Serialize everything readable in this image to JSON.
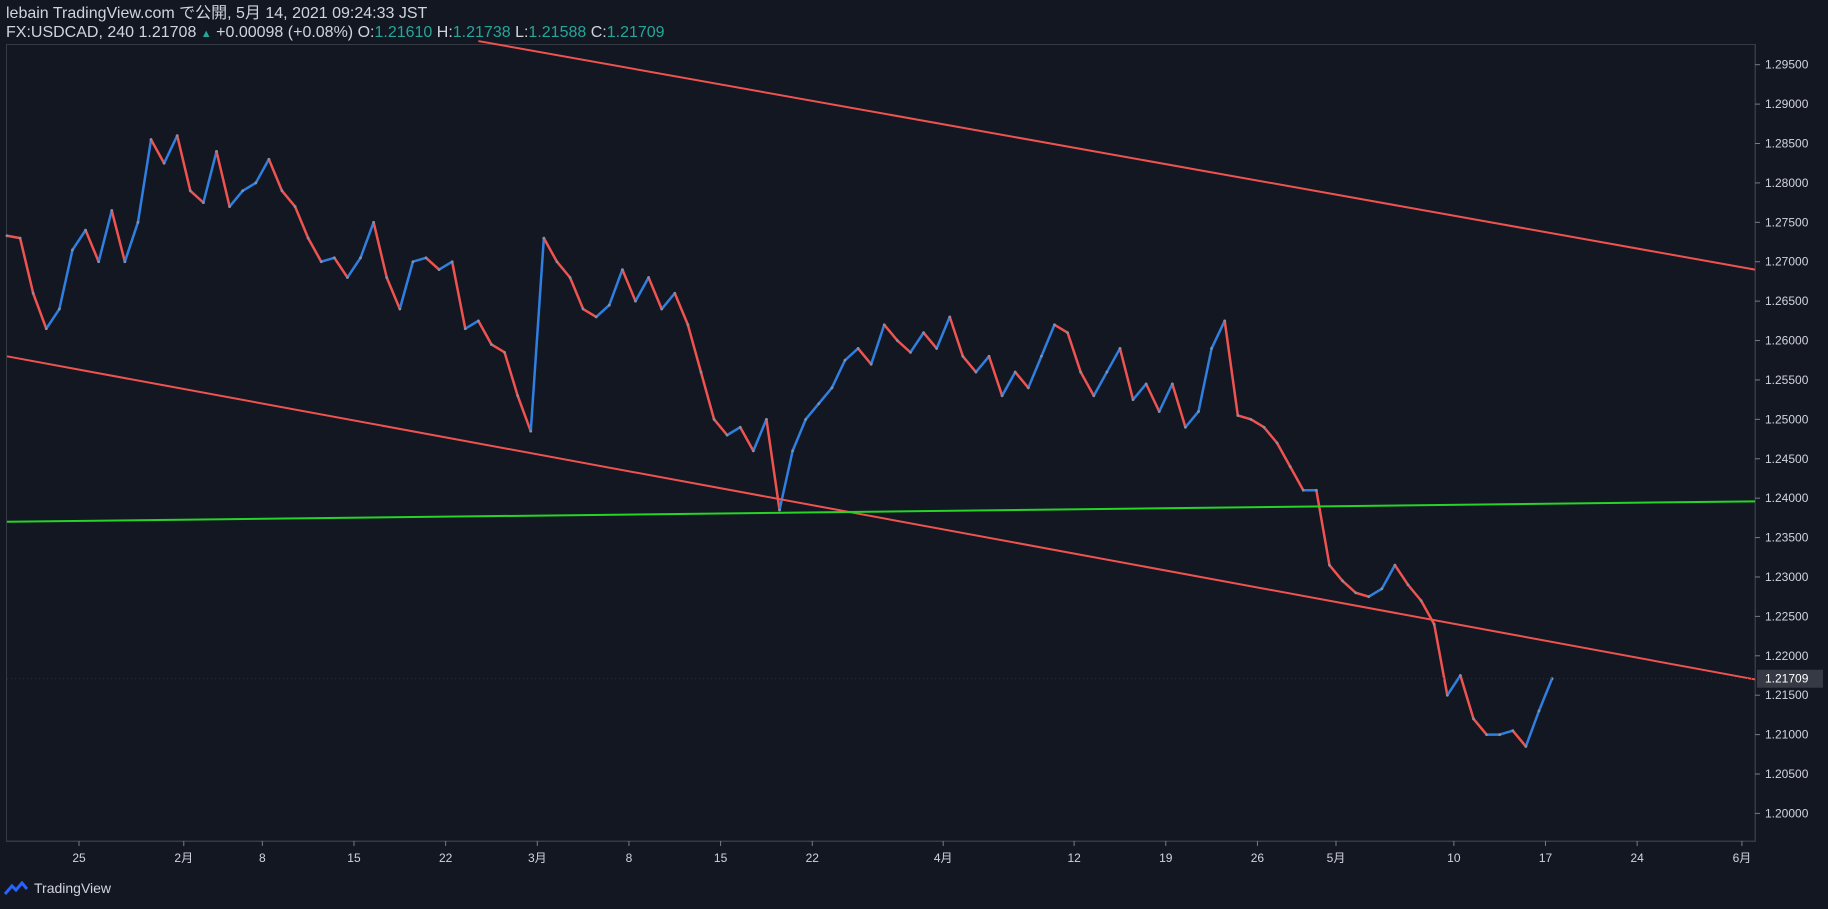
{
  "header": {
    "line1": "lebain TradingView.com で公開, 5月 14, 2021 09:24:33 JST",
    "symbol": "FX:USDCAD, 240",
    "price": "1.21708",
    "change": "+0.00098 (+0.08%)",
    "o_label": "O:",
    "o": "1.21610",
    "h_label": "H:",
    "h": "1.21738",
    "l_label": "L:",
    "l": "1.21588",
    "c_label": "C:",
    "c": "1.21709"
  },
  "footer": {
    "brand": "TradingView"
  },
  "colors": {
    "background": "#131722",
    "up": "#2f7fe0",
    "down": "#ef5350",
    "channel": "#ef5350",
    "support": "#26d426",
    "axis_text": "#d1d4dc"
  },
  "chart_data": {
    "type": "line",
    "title": "",
    "y_ticks": [
      "1.29500",
      "1.29000",
      "1.28500",
      "1.28000",
      "1.27500",
      "1.27000",
      "1.26500",
      "1.26000",
      "1.25500",
      "1.25000",
      "1.24500",
      "1.24000",
      "1.23500",
      "1.23000",
      "1.22500",
      "1.22000",
      "1.21500",
      "1.21000",
      "1.20500",
      "1.20000"
    ],
    "ylim": [
      1.1965,
      1.2975
    ],
    "x_ticks": [
      {
        "day": 25,
        "label": "25"
      },
      {
        "day": 33,
        "label": "2月"
      },
      {
        "day": 39,
        "label": "8"
      },
      {
        "day": 46,
        "label": "15"
      },
      {
        "day": 53,
        "label": "22"
      },
      {
        "day": 60,
        "label": "3月"
      },
      {
        "day": 67,
        "label": "8"
      },
      {
        "day": 74,
        "label": "15"
      },
      {
        "day": 81,
        "label": "22"
      },
      {
        "day": 91,
        "label": "4月"
      },
      {
        "day": 101,
        "label": "12"
      },
      {
        "day": 108,
        "label": "19"
      },
      {
        "day": 115,
        "label": "26"
      },
      {
        "day": 121,
        "label": "5月"
      },
      {
        "day": 130,
        "label": "10"
      },
      {
        "day": 137,
        "label": "17"
      },
      {
        "day": 144,
        "label": "24"
      },
      {
        "day": 152,
        "label": "6月"
      }
    ],
    "xlim": [
      19.5,
      153
    ],
    "last_price_label": "1.21709",
    "last_price": 1.21709,
    "series": [
      {
        "values": [
          [
            19.5,
            1.2733
          ],
          [
            20.5,
            1.273
          ],
          [
            21.5,
            1.266
          ],
          [
            22.5,
            1.2615
          ],
          [
            23.5,
            1.264
          ],
          [
            24.5,
            1.2715
          ],
          [
            25.5,
            1.274
          ],
          [
            26.5,
            1.27
          ],
          [
            27.5,
            1.2765
          ],
          [
            28.5,
            1.27
          ],
          [
            29.5,
            1.275
          ],
          [
            30.5,
            1.2855
          ],
          [
            31.5,
            1.2825
          ],
          [
            32.5,
            1.286
          ],
          [
            33.5,
            1.279
          ],
          [
            34.5,
            1.2775
          ],
          [
            35.5,
            1.284
          ],
          [
            36.5,
            1.277
          ],
          [
            37.5,
            1.279
          ],
          [
            38.5,
            1.28
          ],
          [
            39.5,
            1.283
          ],
          [
            40.5,
            1.279
          ],
          [
            41.5,
            1.277
          ],
          [
            42.5,
            1.273
          ],
          [
            43.5,
            1.27
          ],
          [
            44.5,
            1.2705
          ],
          [
            45.5,
            1.268
          ],
          [
            46.5,
            1.2705
          ],
          [
            47.5,
            1.275
          ],
          [
            48.5,
            1.268
          ],
          [
            49.5,
            1.264
          ],
          [
            50.5,
            1.27
          ],
          [
            51.5,
            1.2705
          ],
          [
            52.5,
            1.269
          ],
          [
            53.5,
            1.27
          ],
          [
            54.5,
            1.2615
          ],
          [
            55.5,
            1.2625
          ],
          [
            56.5,
            1.2595
          ],
          [
            57.5,
            1.2585
          ],
          [
            58.5,
            1.253
          ],
          [
            59.5,
            1.2485
          ],
          [
            60.5,
            1.273
          ],
          [
            61.5,
            1.27
          ],
          [
            62.5,
            1.268
          ],
          [
            63.5,
            1.264
          ],
          [
            64.5,
            1.263
          ],
          [
            65.5,
            1.2645
          ],
          [
            66.5,
            1.269
          ],
          [
            67.5,
            1.265
          ],
          [
            68.5,
            1.268
          ],
          [
            69.5,
            1.264
          ],
          [
            70.5,
            1.266
          ],
          [
            71.5,
            1.262
          ],
          [
            72.5,
            1.256
          ],
          [
            73.5,
            1.25
          ],
          [
            74.5,
            1.248
          ],
          [
            75.5,
            1.249
          ],
          [
            76.5,
            1.246
          ],
          [
            77.5,
            1.25
          ],
          [
            78.5,
            1.2385
          ],
          [
            79.5,
            1.246
          ],
          [
            80.5,
            1.25
          ],
          [
            81.5,
            1.252
          ],
          [
            82.5,
            1.254
          ],
          [
            83.5,
            1.2575
          ],
          [
            84.5,
            1.259
          ],
          [
            85.5,
            1.257
          ],
          [
            86.5,
            1.262
          ],
          [
            87.5,
            1.26
          ],
          [
            88.5,
            1.2585
          ],
          [
            89.5,
            1.261
          ],
          [
            90.5,
            1.259
          ],
          [
            91.5,
            1.263
          ],
          [
            92.5,
            1.258
          ],
          [
            93.5,
            1.256
          ],
          [
            94.5,
            1.258
          ],
          [
            95.5,
            1.253
          ],
          [
            96.5,
            1.256
          ],
          [
            97.5,
            1.254
          ],
          [
            98.5,
            1.258
          ],
          [
            99.5,
            1.262
          ],
          [
            100.5,
            1.261
          ],
          [
            101.5,
            1.256
          ],
          [
            102.5,
            1.253
          ],
          [
            103.5,
            1.256
          ],
          [
            104.5,
            1.259
          ],
          [
            105.5,
            1.2525
          ],
          [
            106.5,
            1.2545
          ],
          [
            107.5,
            1.251
          ],
          [
            108.5,
            1.2545
          ],
          [
            109.5,
            1.249
          ],
          [
            110.5,
            1.251
          ],
          [
            111.5,
            1.259
          ],
          [
            112.5,
            1.2625
          ],
          [
            113.5,
            1.2505
          ],
          [
            114.5,
            1.25
          ],
          [
            115.5,
            1.249
          ],
          [
            116.5,
            1.247
          ],
          [
            117.5,
            1.244
          ],
          [
            118.5,
            1.241
          ],
          [
            119.5,
            1.241
          ],
          [
            120.5,
            1.2315
          ],
          [
            121.5,
            1.2295
          ],
          [
            122.5,
            1.228
          ],
          [
            123.5,
            1.2275
          ],
          [
            124.5,
            1.2285
          ],
          [
            125.5,
            1.2315
          ],
          [
            126.5,
            1.229
          ],
          [
            127.5,
            1.227
          ],
          [
            128.5,
            1.224
          ],
          [
            129.5,
            1.215
          ],
          [
            130.5,
            1.2175
          ],
          [
            131.5,
            1.212
          ],
          [
            132.5,
            1.21
          ],
          [
            133.5,
            1.21
          ],
          [
            134.5,
            1.2105
          ],
          [
            135.5,
            1.2085
          ],
          [
            136.5,
            1.213
          ],
          [
            137.5,
            1.2171
          ]
        ]
      }
    ],
    "lines": [
      {
        "name": "upper-channel",
        "points": [
          [
            55.5,
            1.298
          ],
          [
            153,
            1.269
          ]
        ]
      },
      {
        "name": "lower-channel",
        "points": [
          [
            19.5,
            1.258
          ],
          [
            153,
            1.217
          ]
        ]
      },
      {
        "name": "support",
        "points": [
          [
            19.5,
            1.237
          ],
          [
            153,
            1.2396
          ]
        ]
      }
    ]
  }
}
